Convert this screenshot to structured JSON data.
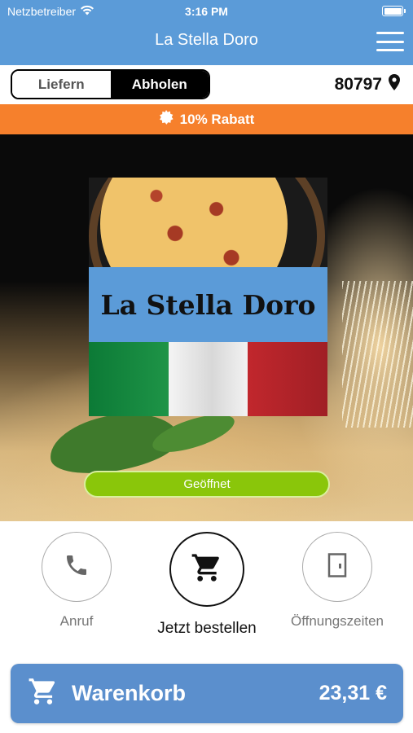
{
  "status_bar": {
    "carrier": "Netzbetreiber",
    "time": "3:16 PM"
  },
  "nav": {
    "title": "La Stella Doro",
    "menu_icon": "hamburger-menu-icon"
  },
  "mode": {
    "delivery_label": "Liefern",
    "pickup_label": "Abholen",
    "selected": "pickup"
  },
  "location": {
    "postal_code": "80797",
    "icon": "map-pin-icon"
  },
  "discount": {
    "label": "10% Rabatt",
    "icon": "badge-star-icon"
  },
  "hero": {
    "logo_text": "La Stella Doro",
    "open_status": "Geöffnet"
  },
  "actions": {
    "call_label": "Anruf",
    "order_label": "Jetzt bestellen",
    "hours_label": "Öffnungszeiten"
  },
  "cart": {
    "title": "Warenkorb",
    "total": "23,31 €"
  },
  "colors": {
    "primary": "#5b9bd8",
    "discount": "#f6802c",
    "open": "#8ac60a",
    "cart": "#5b8fcd"
  }
}
